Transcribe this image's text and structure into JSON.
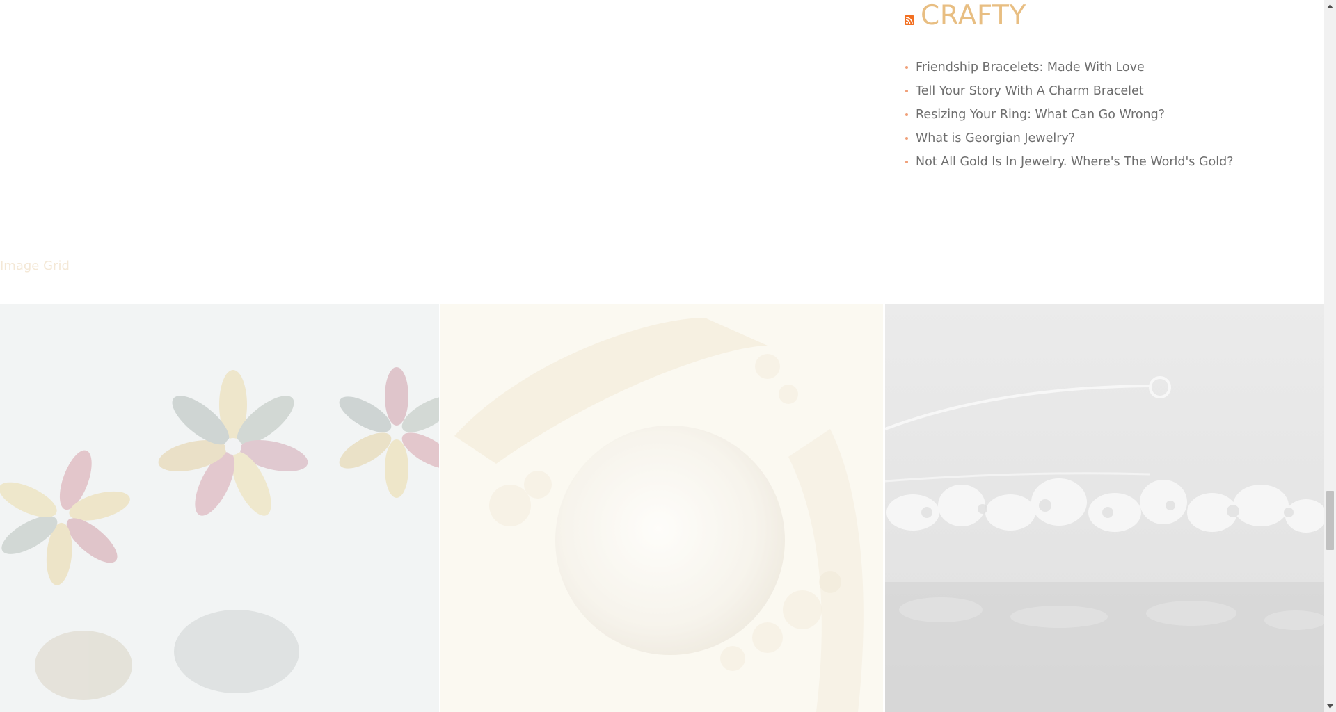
{
  "rss_widget": {
    "icon": "rss-feed-icon",
    "title": "CRAFTY",
    "items": [
      {
        "label": "Friendship Bracelets: Made With Love"
      },
      {
        "label": "Tell Your Story With A Charm Bracelet"
      },
      {
        "label": "Resizing Your Ring: What Can Go Wrong?"
      },
      {
        "label": "What is Georgian Jewelry?"
      },
      {
        "label": "Not All Gold Is In Jewelry. Where's The World's Gold?"
      }
    ]
  },
  "image_grid": {
    "label": "Image Grid",
    "tiles": [
      {
        "subject": "amber-flower-earrings"
      },
      {
        "subject": "pearl-ring"
      },
      {
        "subject": "crystal-tiara"
      }
    ]
  },
  "scrollbar": {
    "up_icon": "scroll-up-arrow-icon",
    "down_icon": "scroll-down-arrow-icon"
  },
  "colors": {
    "title": "#e8be82",
    "link": "#6e6e6e",
    "bullet": "#f0a079",
    "rss_icon": "#f26f21"
  }
}
